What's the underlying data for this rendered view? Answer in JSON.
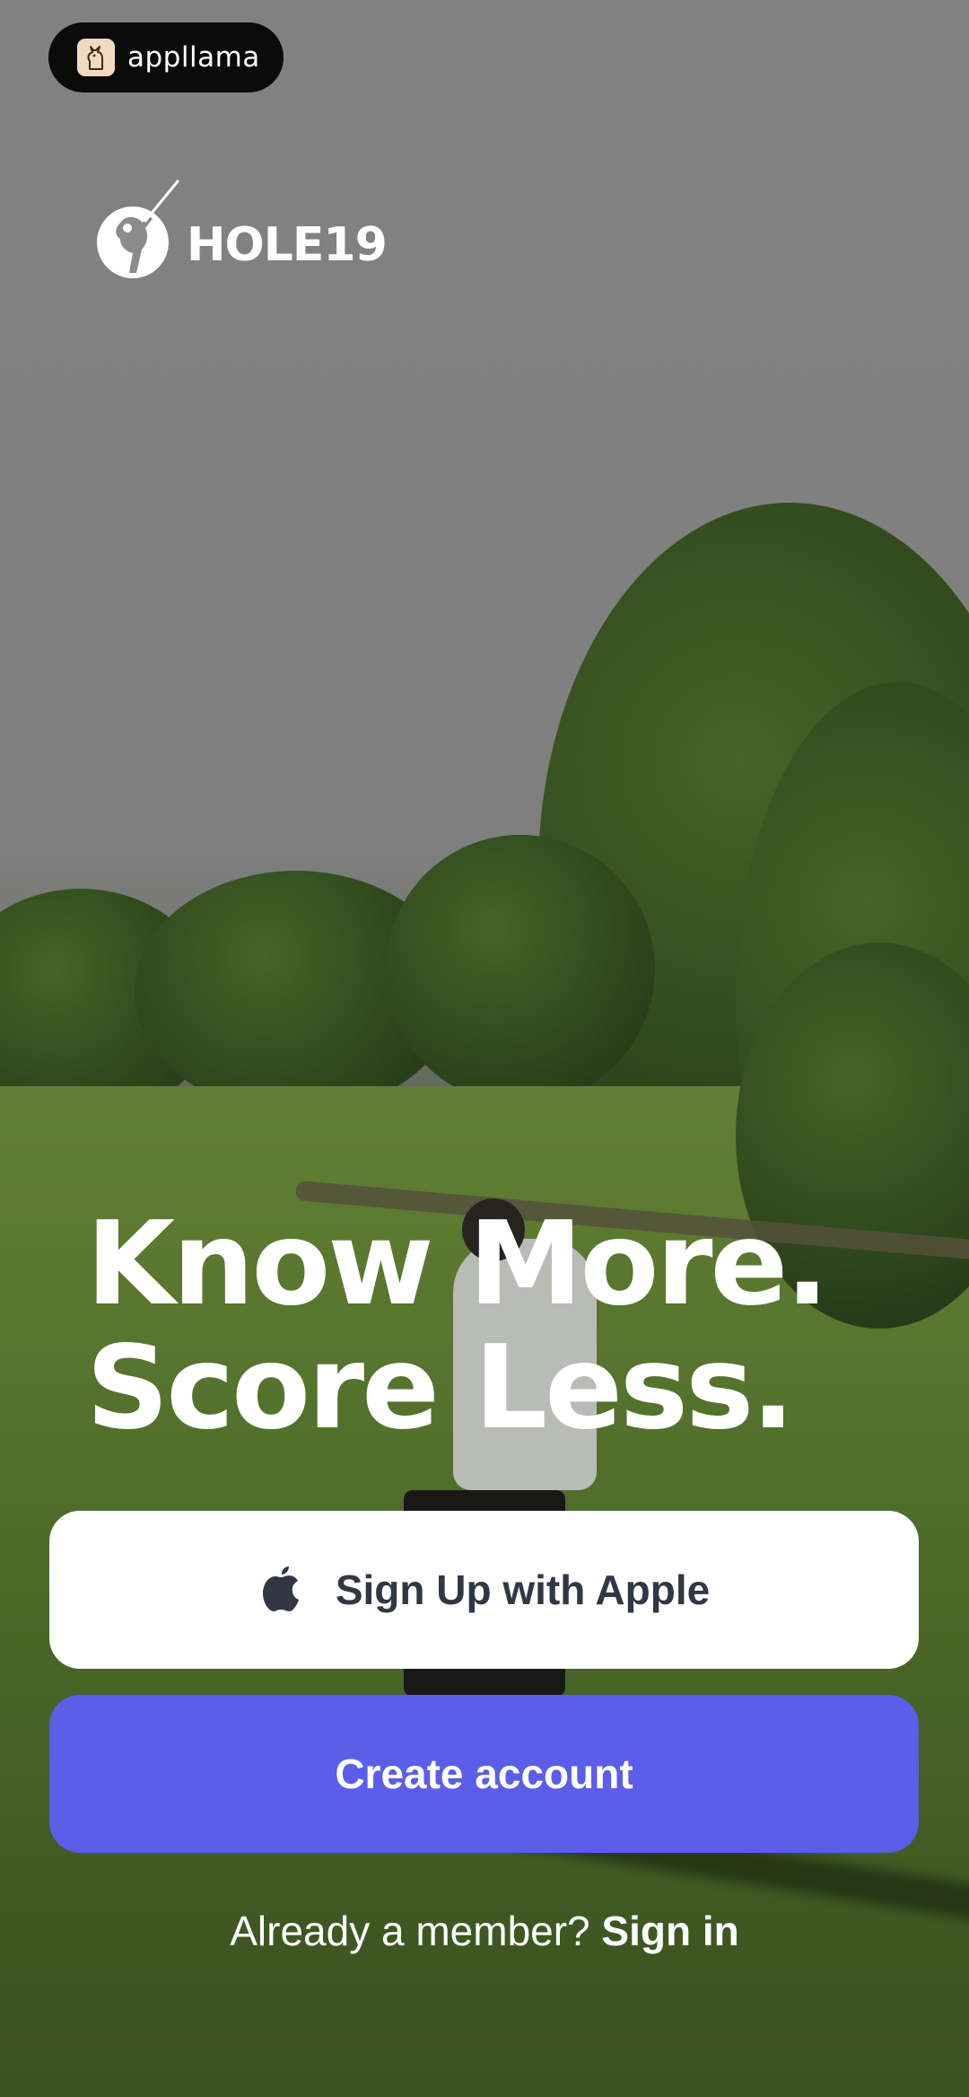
{
  "badge": {
    "label": "appllama",
    "icon": "llama-icon"
  },
  "brand": {
    "name": "HOLE19",
    "icon": "golfer-logo-icon"
  },
  "hero": {
    "line1": "Know More.",
    "line2": "Score Less."
  },
  "buttons": {
    "apple_label": "Sign Up with Apple",
    "apple_icon": "apple-icon",
    "create_label": "Create account"
  },
  "signin": {
    "prompt": "Already a member?",
    "link": "Sign in"
  },
  "colors": {
    "primary": "#5a5ee8",
    "apple_button_bg": "#ffffff",
    "apple_button_text": "#323744"
  }
}
